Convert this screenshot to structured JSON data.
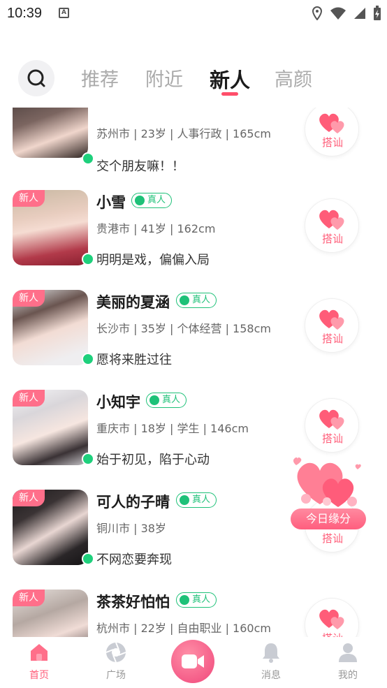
{
  "status_bar": {
    "time": "10:39",
    "notif_icon": "A"
  },
  "tabs": [
    {
      "label": "推荐",
      "active": false
    },
    {
      "label": "附近",
      "active": false
    },
    {
      "label": "新人",
      "active": true
    },
    {
      "label": "高颜",
      "active": false
    }
  ],
  "users": [
    {
      "name": "",
      "meta": "苏州市 | 23岁 | 人事行政 | 165cm",
      "bio": "交个朋友嘛！！",
      "new_tag": "",
      "verified": "",
      "greet": "搭讪",
      "online": true
    },
    {
      "name": "小雪",
      "meta": "贵港市 | 41岁 | 162cm",
      "bio": "明明是戏，偏偏入局",
      "new_tag": "新人",
      "verified": "真人",
      "greet": "搭讪",
      "online": true
    },
    {
      "name": "美丽的夏涵",
      "meta": "长沙市 | 35岁 | 个体经营 | 158cm",
      "bio": "愿将来胜过往",
      "new_tag": "新人",
      "verified": "真人",
      "greet": "搭讪",
      "online": true
    },
    {
      "name": "小知宇",
      "meta": "重庆市 | 18岁 | 学生 | 146cm",
      "bio": "始于初见，陷于心动",
      "new_tag": "新人",
      "verified": "真人",
      "greet": "搭讪",
      "online": true
    },
    {
      "name": "可人的子晴",
      "meta": "铜川市 | 38岁",
      "bio": "不网恋要奔现",
      "new_tag": "新人",
      "verified": "真人",
      "greet": "搭讪",
      "online": true
    },
    {
      "name": "茶茶好怕怕",
      "meta": "杭州市 | 22岁 | 自由职业 | 160cm",
      "bio": "",
      "new_tag": "新人",
      "verified": "真人",
      "greet": "搭讪",
      "online": false
    }
  ],
  "fortune": {
    "label": "今日缘分"
  },
  "bottom_nav": {
    "home": "首页",
    "square": "广场",
    "messages": "消息",
    "mine": "我的"
  },
  "colors": {
    "accent": "#ff5c78",
    "online": "#1ed07c",
    "verified": "#1ec178"
  }
}
